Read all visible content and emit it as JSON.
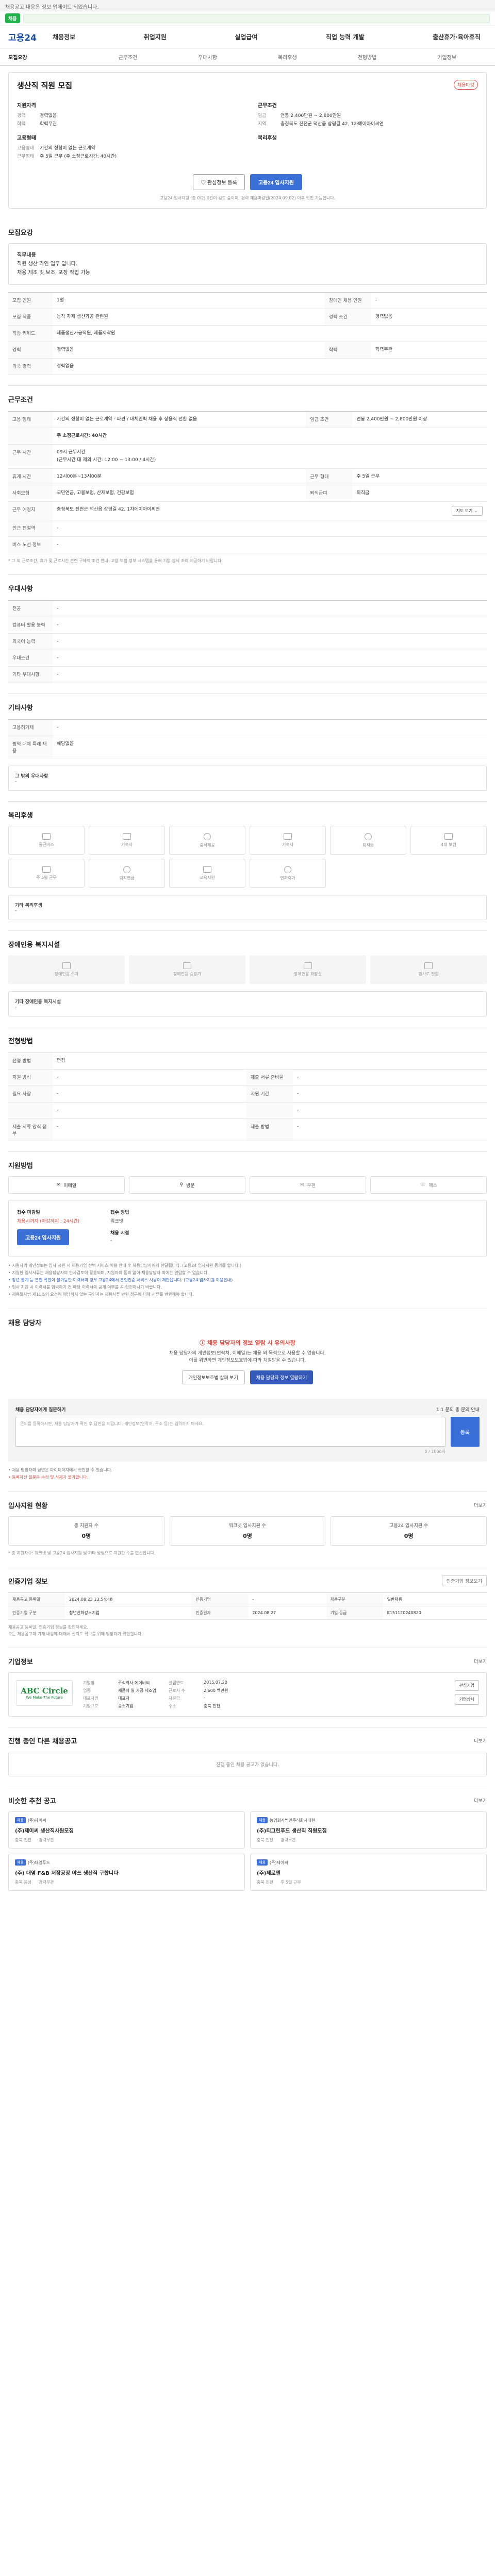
{
  "banner": "채용공고 내용은 정보 업데이트 되었습니다.",
  "pill": "채용",
  "logo": "고용24",
  "gnb": [
    "채용정보",
    "취업지원",
    "실업급여",
    "직업 능력 개발",
    "출산휴가·육아휴직"
  ],
  "tabs": [
    "모집요강",
    "근무조건",
    "우대사항",
    "복리후생",
    "전형방법",
    "기업정보"
  ],
  "summary": {
    "title": "생산직 직원 모집",
    "badge": "채용마감",
    "left_label": "지원자격",
    "left_rows": [
      [
        "경력",
        "경력없음"
      ],
      [
        "학력",
        "학력무관"
      ]
    ],
    "right_label": "근무조건",
    "right_rows": [
      [
        "임금",
        "연봉 2,400만원 ~ 2,800만원"
      ],
      [
        "지역",
        "충청북도 진천군 덕산읍 상평길 42, 1차에이아이씨앤"
      ]
    ],
    "left_label2": "고용형태",
    "left_rows2": [
      [
        "고용형태",
        "기간의 정함이 없는 근로계약"
      ],
      [
        "근무형태",
        "주 5일 근무 (주 소정근로시간: 40시간)"
      ]
    ],
    "right_label2": "복리후생",
    "btn_scrap": "관심정보 등록",
    "btn_apply": "고용24 입사지원",
    "note": "고용24 입사지원 (총 0/2) 0건이 검토 중이며, 경력 채용마감일(2024.09.02) 이후 확인 가능합니다."
  },
  "recruit": {
    "title": "모집요강",
    "box_title": "직무내용",
    "box_lines": [
      "직원 생산 라인 업무 입니다.",
      "채용 제조 및 보조, 포장 작업 가능"
    ],
    "rows": [
      [
        [
          "모집 인원",
          "1명"
        ],
        [
          "장애인 채용 인원",
          "-"
        ]
      ],
      [
        [
          "모집 직종",
          "농작 자재 생산가공 관련원"
        ],
        [
          "경력 조건",
          "경력없음"
        ]
      ],
      [
        [
          "직종 키워드",
          "제품생산가공직원, 제품제작원"
        ],
        [
          "",
          ""
        ]
      ],
      [
        [
          "경력",
          "경력없음"
        ],
        [
          "학력",
          "학력무관"
        ]
      ],
      [
        [
          "외국 경력",
          "경력없음"
        ],
        [
          "",
          ""
        ]
      ]
    ]
  },
  "conditions": {
    "title": "근무조건",
    "rows": [
      [
        [
          "고용 형태",
          "기간의 정함이 없는 근로계약 · 파견 / 대체인력 채용 후 상용직 전환 없음"
        ],
        [
          "임금 조건",
          "연봉 2,400만원 ~ 2,800만원 이상"
        ]
      ],
      [
        [
          "",
          "주 소정근로시간: 40시간"
        ],
        [
          "",
          ""
        ]
      ],
      [
        [
          "근무 시간",
          "09시 근무시간\n(근무시간 대 제외 시간: 12:00 ~ 13:00 / 4시간)"
        ],
        [
          "",
          ""
        ]
      ],
      [
        [
          "휴게 시간",
          "12시00분~13시00분"
        ],
        [
          "근무 형태",
          "주 5일 근무"
        ]
      ],
      [
        [
          "사회보험",
          "국민연금, 고용보험, 산재보험, 건강보험"
        ],
        [
          "퇴직급여",
          "퇴직금"
        ]
      ],
      [
        [
          "근무 예정지",
          "충청북도 진천군 덕산읍 상평길 42, 1차에이아이씨앤"
        ],
        [
          "",
          ""
        ]
      ],
      [
        [
          "인근 전철역",
          "-"
        ],
        [
          "",
          ""
        ]
      ],
      [
        [
          "버스 노선 정보",
          "-"
        ],
        [
          "",
          ""
        ]
      ]
    ],
    "map_btn": "지도 보기",
    "note": "* 그 외 근로조건, 휴가 및 근로시간 관련 구체적 조건 안내: 고용 보험 정보 시스템을 통해 기업 상세 조회 제공하기 바랍니다."
  },
  "prefer": {
    "title": "우대사항",
    "rows": [
      [
        "전공",
        "-"
      ],
      [
        "컴퓨터 활용 능력",
        "-"
      ],
      [
        "외국어 능력",
        "-"
      ],
      [
        "우대조건",
        "-"
      ],
      [
        "기타 우대사항",
        "-"
      ]
    ]
  },
  "etc": {
    "title": "기타사항",
    "rows": [
      [
        "고용허가제",
        "-"
      ],
      [
        "병역 대체 특례 채용",
        "해당없음"
      ]
    ],
    "box_title": "그 밖의 우대사항",
    "box_text": "-"
  },
  "welfare": {
    "title": "복리후생",
    "items": [
      "통근버스",
      "기숙사",
      "중식제공",
      "기숙사",
      "퇴직금",
      "4대 보험",
      "주 5일 근무",
      "퇴직연금",
      "교육지원",
      "연차휴가",
      "",
      ""
    ],
    "box_title": "기타 복리후생",
    "box_text": "-"
  },
  "disabled": {
    "title": "장애인용 복지시설",
    "items": [
      "장애인용 주차",
      "장애인용 승강기",
      "장애인용 화장실",
      "경사로 진입"
    ],
    "box_title": "기타 장애인용 복지시설",
    "box_text": "-"
  },
  "selection": {
    "title": "전형방법",
    "rows": [
      [
        [
          "전형 방법",
          "면접"
        ],
        [
          "",
          ""
        ]
      ],
      [
        [
          "지원 방식",
          "-"
        ],
        [
          "제출 서류 준비물",
          "-"
        ]
      ],
      [
        [
          "필요 사항",
          "-"
        ],
        [
          "지원 기간",
          "-"
        ]
      ],
      [
        [
          "",
          "-"
        ],
        [
          "",
          "-"
        ]
      ],
      [
        [
          "제출 서류 양식 첨부",
          "-"
        ],
        [
          "제출 방법",
          "-"
        ]
      ]
    ]
  },
  "apply": {
    "title": "지원방법",
    "methods": [
      "이메일",
      "방문",
      "우편",
      "팩스"
    ],
    "l1": "접수 마감일",
    "v1": "채용시까지 (마감까지 : 24시간)",
    "l2": "접수 방법",
    "v2": "워크넷",
    "l3": "채용 시점",
    "v3": "-",
    "btn": "고용24 입사지원",
    "bullets": [
      "지원자의 개인정보는 입사 지원 시 채용기업 선택 서비스 이용 안내 후 채용담당자에게 전달됩니다. (고용24 입사지원 동의를 합니다.)",
      "지원한 입사서류는 채용담당자의 인사검토에 활용되며, 지원자의 동의 없이 채용담당자 외에는 열람할 수 없습니다.",
      "장년 통계 등 본인 확인이 불가능한 이력서의 경우 고용24에서 본인인증 서비스 사용이 제한됩니다. (고용24 입사지원 이용안내)",
      "입사 지원 시 이력서를 입력하기 전 해당 이력서의 공개 여부를 꼭 확인하시기 바랍니다.",
      "채용절차법 제11조의 요건에 해당하지 않는 구인자는 채용서류 반환 청구에 대해 서류를 반환해야 합니다."
    ]
  },
  "contact": {
    "title": "채용 담당자",
    "alert": "채용 담당자의 정보 열람 시 유의사항",
    "desc1": "채용 담당자의 개인정보(연락처, 이메일)는 채용 외 목적으로 사용할 수 없습니다.",
    "desc2": "이를 위반하면 개인정보보호법에 따라 처벌받을 수 있습니다.",
    "btn1": "개인정보보호법 살펴 보기",
    "btn2": "채용 담당자 정보 열람하기",
    "qa_title": "채용 담당자에게 질문하기",
    "qa_guide": "1:1 문의 총 문의 안내",
    "qa_placeholder": "문의를 등록하시면, 채용 담당자가 확인 후 답변을 드립니다. 개인정보(연락처, 주소 등)는 입력하지 마세요.",
    "qa_submit": "등록",
    "qa_count": "0 / 1000자",
    "qa_bullets": [
      "채용 담당자의 답변은 마이페이지에서 확인할 수 있습니다.",
      "등록하신 질문은 수정 및 삭제가 불가합니다."
    ]
  },
  "status": {
    "title": "입사지원 현황",
    "link": "더보기",
    "cells": [
      [
        "총 지원자 수",
        "0명"
      ],
      [
        "워크넷 입사지원 수",
        "0명"
      ],
      [
        "고용24 입사지원 수",
        "0명"
      ]
    ],
    "note": "* 총 지원자수: 워크넷 및 고용24 입사지원 및 기타 방법으로 지원한 수를 합산합니다."
  },
  "info": {
    "title": "인증기업 정보",
    "link": "인증기업 정보보기",
    "rows": [
      [
        [
          "채용공고 등록일",
          "2024.08.23 13:54:48"
        ],
        [
          "인증기업",
          "-"
        ],
        [
          "채용구분",
          "일반채용"
        ]
      ],
      [
        [
          "인증기업 구분",
          "청년친화강소기업"
        ],
        [
          "인증일자",
          "2024.08.27"
        ],
        [
          "기업 등급",
          "K151120240820"
        ]
      ]
    ],
    "notes": [
      "채용공고 등록일, 인증기업 정보를 확인하세요.",
      "모든 채용공고의 기재 내용에 대해서 신뢰도 확보를 위해 담당자가 확인합니다."
    ]
  },
  "company": {
    "title": "기업정보",
    "link": "더보기",
    "logo1": "ABC Circle",
    "logo2": "We Make The Future",
    "k": [
      "기업명",
      "업종",
      "대표자명",
      "기업규모",
      "설립연도",
      "근로자 수",
      "주소",
      "자본금"
    ],
    "v": [
      "주식회사 에이비씨",
      "제품의 일 가공 제조업",
      "대표자",
      "중소기업",
      "2015.07.20",
      "2,600 백만원",
      "충북 진천",
      "-"
    ],
    "btn1": "관심기업",
    "btn2": "기업상세"
  },
  "others": {
    "title": "진행 중인 다른 채용공고",
    "link": "더보기",
    "empty": "진행 중인 채용 공고가 없습니다."
  },
  "similar": {
    "title": "비슷한 추천 공고",
    "link": "더보기",
    "cards": [
      {
        "co": "(주)제이씨",
        "title": "(주)제이씨 생산직사원모집",
        "loc1": "충북 진천",
        "loc2": "경력무관"
      },
      {
        "co": "농업회사법인주식회사대한",
        "title": "(주)티그린푸드 생산직 직원모집",
        "loc1": "충북 진천",
        "loc2": "경력무관"
      },
      {
        "co": "(주)대영푸드",
        "title": "(주) 대영 F&B 저장공장 야쓰 생산직 구합니다",
        "loc1": "충북 음성",
        "loc2": "경력무관"
      },
      {
        "co": "(주)제이씨",
        "title": "(주)제로엔",
        "loc1": "충북 진천",
        "loc2": "주 5일 근무"
      }
    ]
  }
}
